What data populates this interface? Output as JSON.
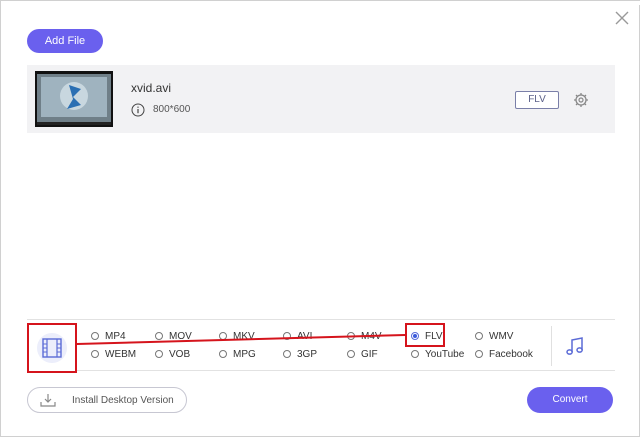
{
  "toolbar": {
    "add_file_label": "Add File"
  },
  "file": {
    "name": "xvid.avi",
    "resolution": "800*600",
    "output_format": "FLV"
  },
  "formats": {
    "row1": [
      "MP4",
      "MOV",
      "MKV",
      "AVI",
      "M4V",
      "FLV",
      "WMV"
    ],
    "row2": [
      "WEBM",
      "VOB",
      "MPG",
      "3GP",
      "GIF",
      "YouTube",
      "Facebook"
    ],
    "selected": "FLV"
  },
  "footer": {
    "install_label": "Install Desktop Version",
    "convert_label": "Convert"
  },
  "colors": {
    "accent": "#6a60ee",
    "highlight": "#d5141c"
  }
}
